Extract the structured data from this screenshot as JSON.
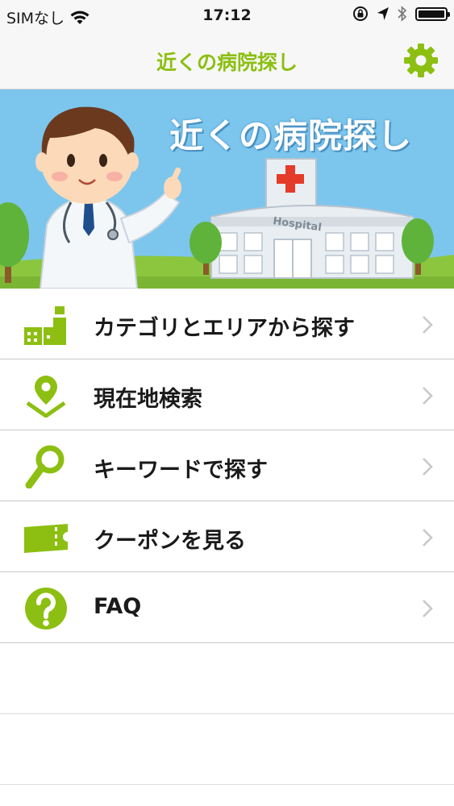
{
  "status_bar": {
    "carrier": "SIMなし",
    "time": "17:12"
  },
  "nav": {
    "title": "近くの病院探し",
    "settings_icon": "gear-icon",
    "accent_color": "#8cbf11"
  },
  "banner": {
    "title": "近くの病院探し",
    "hospital_sign": "Hospital"
  },
  "menu": {
    "items": [
      {
        "label": "カテゴリとエリアから探す",
        "icon": "category-area-icon"
      },
      {
        "label": "現在地検索",
        "icon": "location-pin-icon"
      },
      {
        "label": "キーワードで探す",
        "icon": "magnifier-icon"
      },
      {
        "label": "クーポンを見る",
        "icon": "coupon-ticket-icon"
      },
      {
        "label": "FAQ",
        "icon": "question-icon"
      }
    ]
  }
}
